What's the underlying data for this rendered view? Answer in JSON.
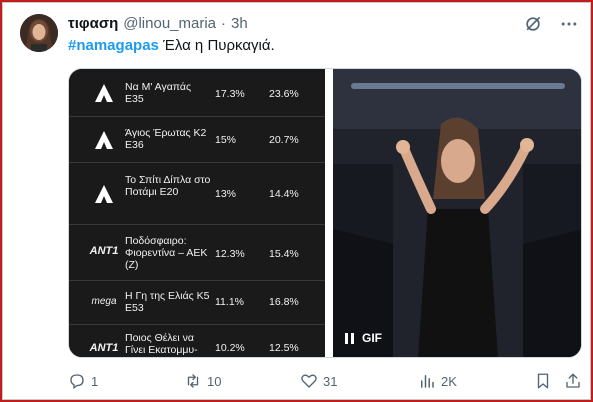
{
  "tweet": {
    "author_name": "τιφαση",
    "handle": "@linou_maria",
    "separator": "·",
    "time": "3h",
    "hashtag": "#namagapas",
    "text": " Έλα η Πυρκαγιά."
  },
  "table": {
    "rows": [
      {
        "logo": "alpha-logo",
        "show": "Να Μ' Αγαπάς Ε35",
        "v1": "17.3%",
        "v2": "23.6%"
      },
      {
        "logo": "alpha-logo",
        "show": "Άγιος Έρωτας Κ2 Ε36",
        "v1": "15%",
        "v2": "20.7%"
      },
      {
        "logo": "alpha-logo",
        "show": "Το Σπίτι Δίπλα στο Ποτάμι Ε20",
        "v1": "13%",
        "v2": "14.4%"
      },
      {
        "logo": "ant1-logo",
        "show": "Ποδόσφαιρο: Φιορεντίνα – ΑΕΚ (Ζ)",
        "v1": "12.3%",
        "v2": "15.4%"
      },
      {
        "logo": "mega-logo",
        "show": "Η Γη της Ελιάς Κ5 Ε53",
        "v1": "11.1%",
        "v2": "16.8%"
      },
      {
        "logo": "ant1-logo",
        "show": "Ποιος Θέλει να Γίνει Εκατομμυ-",
        "v1": "10.2%",
        "v2": "12.5%"
      }
    ],
    "logo_text": {
      "alpha": "A",
      "ant1": "ANT1",
      "mega": "mega"
    }
  },
  "video": {
    "gif_label": "GIF"
  },
  "actions": {
    "replies": "1",
    "retweets": "10",
    "likes": "31",
    "views": "2K"
  },
  "colors": {
    "accent": "#1d9bf0",
    "frame": "#c21d1d",
    "muted": "#536471"
  }
}
